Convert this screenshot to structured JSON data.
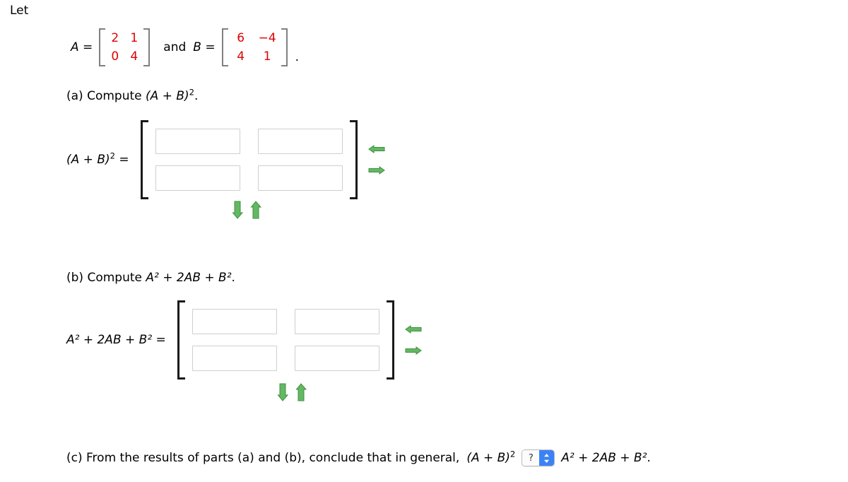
{
  "intro": {
    "text": "Let"
  },
  "given": {
    "matrix_a": {
      "name": "A",
      "equals": "=",
      "rows": [
        [
          "2",
          "1"
        ],
        [
          "0",
          "4"
        ]
      ],
      "value_color": "#e00000"
    },
    "conjunction": "and",
    "matrix_b": {
      "name": "B",
      "equals": "=",
      "rows": [
        [
          "6",
          "−4"
        ],
        [
          "4",
          "1"
        ]
      ],
      "value_color": "#e00000"
    },
    "trailing_punctuation": "."
  },
  "parts": {
    "a": {
      "heading_prefix": "(a) Compute",
      "heading_expr_base": "(A + B)",
      "heading_expr_exponent": "2",
      "heading_suffix": ".",
      "answer_label_base": "(A + B)",
      "answer_label_exponent": "2",
      "answer_label_equals": "=",
      "cells": [
        {
          "name": "row1-col1",
          "value": "",
          "placeholder": ""
        },
        {
          "name": "row1-col2",
          "value": "",
          "placeholder": ""
        },
        {
          "name": "row2-col1",
          "value": "",
          "placeholder": ""
        },
        {
          "name": "row2-col2",
          "value": "",
          "placeholder": ""
        }
      ],
      "controls": {
        "remove_column": "remove-column-arrow-left",
        "add_column": "add-column-arrow-right",
        "add_row": "add-row-arrow-down",
        "remove_row": "remove-row-arrow-up"
      }
    },
    "b": {
      "heading_prefix": "(b) Compute",
      "heading_expr": "A² + 2AB + B²",
      "heading_suffix": ".",
      "answer_label_equals": "=",
      "cells": [
        {
          "name": "row1-col1",
          "value": "",
          "placeholder": ""
        },
        {
          "name": "row1-col2",
          "value": "",
          "placeholder": ""
        },
        {
          "name": "row2-col1",
          "value": "",
          "placeholder": ""
        },
        {
          "name": "row2-col2",
          "value": "",
          "placeholder": ""
        }
      ],
      "controls": {
        "remove_column": "remove-column-arrow-left",
        "add_column": "add-column-arrow-right",
        "add_row": "add-row-arrow-down",
        "remove_row": "remove-row-arrow-up"
      }
    },
    "c": {
      "text_before": "(c) From the results of parts (a) and (b), conclude that in general,",
      "left_expr_base": "(A + B)",
      "left_expr_exponent": "2",
      "selector": {
        "value": "?",
        "icon": "updown-chevron-icon"
      },
      "right_expr": "A² + 2AB + B²",
      "text_after": "."
    }
  },
  "colors": {
    "matrix_values": "#e00000",
    "arrow_green": "#5cb85c",
    "selector_blue": "#3b82f6",
    "input_border": "#cfcfcf",
    "bracket_dark": "#1a1a1a",
    "bracket_gray": "#808080"
  }
}
